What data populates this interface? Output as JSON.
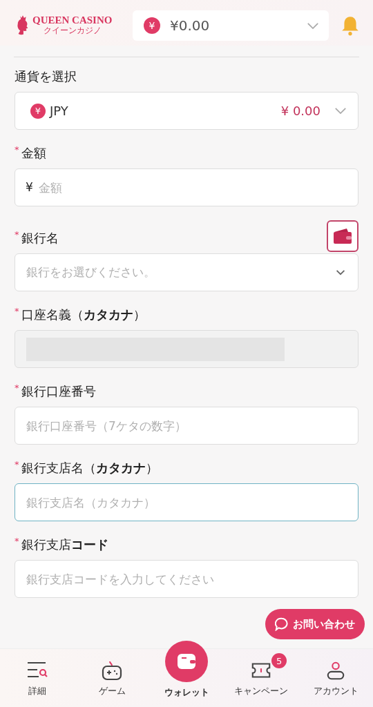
{
  "header": {
    "logo": {
      "name": "QUEEN CASINO",
      "sub": "クイーンカジノ"
    },
    "balance": {
      "symbol": "¥",
      "amount": "¥0.00"
    }
  },
  "form": {
    "required_mark": "*",
    "fields": [
      {
        "kind": "currency",
        "label": "通貨を選択",
        "required": false,
        "symbol": "¥",
        "code": "JPY",
        "amount": "¥ 0.00"
      },
      {
        "kind": "input",
        "label": "金額",
        "required": true,
        "prefix": "¥",
        "placeholder": "金額",
        "focused": false
      },
      {
        "kind": "select",
        "label": "銀行名",
        "required": true,
        "placeholder": "銀行をお選びください。",
        "wallet_button": true
      },
      {
        "kind": "masked",
        "label": "口座名義（**カタカナ**）",
        "required": true
      },
      {
        "kind": "input",
        "label": "銀行口座番号",
        "required": true,
        "placeholder": "銀行口座番号（7ケタの数字）",
        "focused": false
      },
      {
        "kind": "input",
        "label": "銀行支店名（**カタカナ**）",
        "required": true,
        "placeholder": "銀行支店名（カタカナ）",
        "focused": true
      },
      {
        "kind": "input",
        "label": "銀行支店**コード**",
        "required": true,
        "placeholder": "銀行支店コードを入力してください",
        "focused": false
      }
    ]
  },
  "contact_button": {
    "label": "お問い合わせ"
  },
  "bottom_nav": [
    {
      "kind": "menu",
      "label": "詳細",
      "selected": false
    },
    {
      "kind": "game",
      "label": "ゲーム",
      "selected": false
    },
    {
      "kind": "wallet",
      "label": "ウォレット",
      "selected": true
    },
    {
      "kind": "ticket",
      "label": "キャンペーン",
      "selected": false,
      "badge": "5"
    },
    {
      "kind": "account",
      "label": "アカウント",
      "selected": false
    }
  ]
}
